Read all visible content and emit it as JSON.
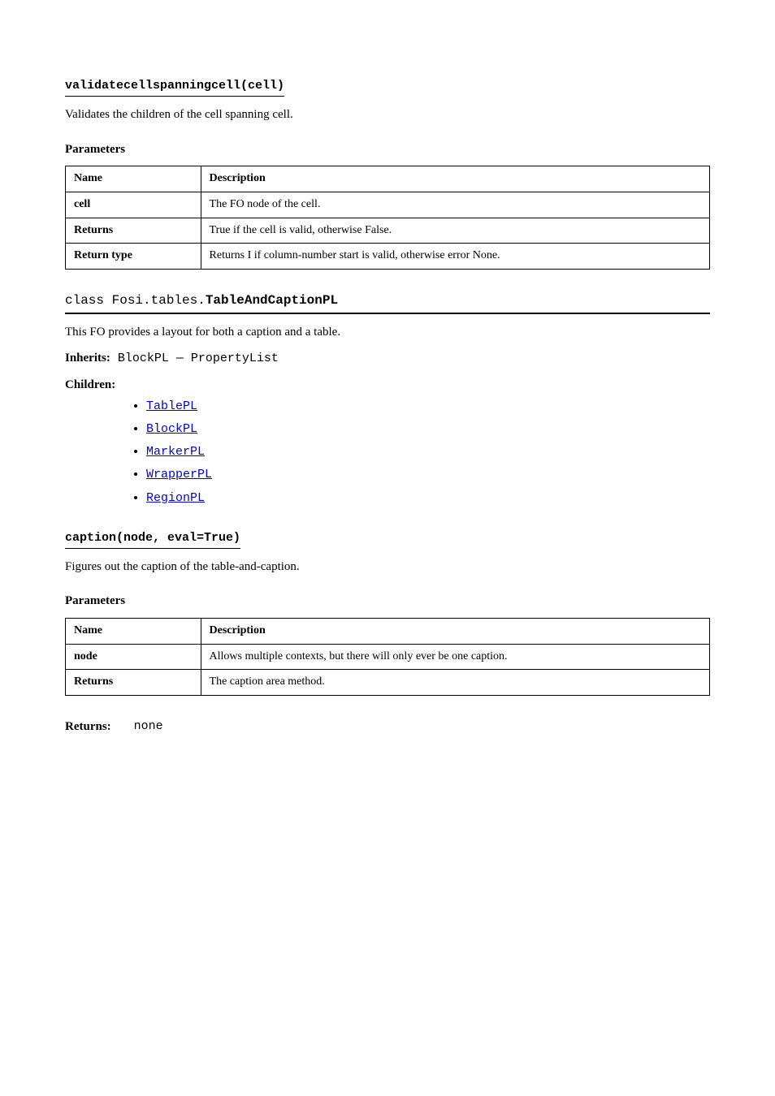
{
  "method1": {
    "signature": "validatecellspanningcell(cell)",
    "description": "Validates the children of the cell spanning cell.",
    "parameters_label": "Parameters",
    "param_table": {
      "header_name": "Name",
      "header_desc": "Description",
      "rows": [
        {
          "name": "cell",
          "desc": "The FO node of the cell."
        },
        {
          "name": "Returns",
          "desc": "True if the cell is valid, otherwise False."
        },
        {
          "name": "Return type",
          "desc": "Returns I if column-number start is valid, otherwise error None."
        }
      ]
    }
  },
  "class1": {
    "title_thin": "class Fosi.tables.",
    "title_bold": "TableAndCaptionPL",
    "description": "This FO provides a layout for both a caption and a table.",
    "inherits_label": "Inherits:",
    "inherits_value": "BlockPL — PropertyList",
    "children_label": "Children:",
    "children": [
      "TablePL",
      "BlockPL",
      "MarkerPL",
      "WrapperPL",
      "RegionPL"
    ]
  },
  "method2": {
    "signature": "caption(node, eval=True)",
    "description": "Figures out the caption of the table-and-caption.",
    "parameters_label": "Parameters",
    "param_table": {
      "header_name": "Name",
      "header_desc": "Description",
      "rows": [
        {
          "name": "node",
          "desc": "Allows multiple contexts, but there will only ever be one caption."
        },
        {
          "name": "Returns",
          "desc": "The caption area method."
        }
      ]
    }
  },
  "returns": {
    "label": "Returns:",
    "value": "none"
  }
}
